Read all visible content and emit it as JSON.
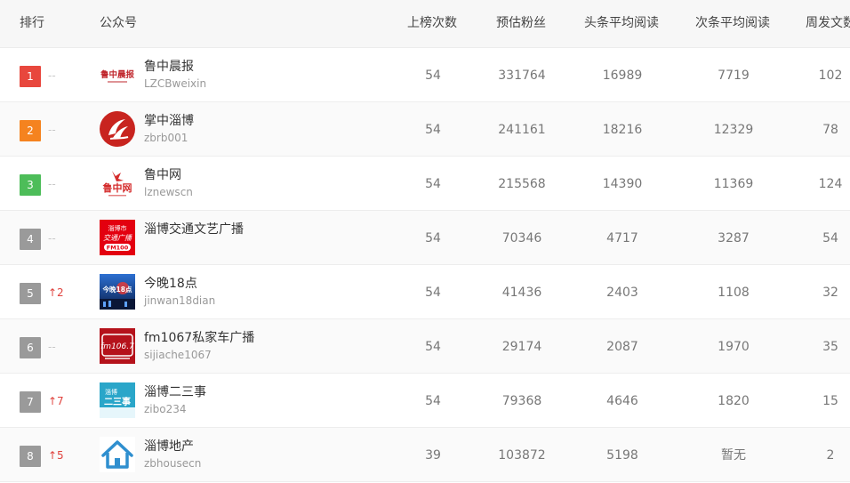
{
  "header": {
    "rank": "排行",
    "account": "公众号",
    "times": "上榜次数",
    "fans": "预估粉丝",
    "head_avg": "头条平均阅读",
    "second_avg": "次条平均阅读",
    "weekly": "周发文数"
  },
  "rank_colors": {
    "1": "#e8473d",
    "2": "#f5831f",
    "3": "#4dbd59",
    "other": "#9a9a9a"
  },
  "rows": [
    {
      "rank": "1",
      "trend": "--",
      "name": "鲁中晨报",
      "wx": "LZCBweixin",
      "times": "54",
      "fans": "331764",
      "head": "16989",
      "second": "7719",
      "weekly": "102",
      "avatar": "luzhong-chenbao-logo"
    },
    {
      "rank": "2",
      "trend": "--",
      "name": "掌中淄博",
      "wx": "zbrb001",
      "times": "54",
      "fans": "241161",
      "head": "18216",
      "second": "12329",
      "weekly": "78",
      "avatar": "zhangzhong-zibo-logo"
    },
    {
      "rank": "3",
      "trend": "--",
      "name": "鲁中网",
      "wx": "lznewscn",
      "times": "54",
      "fans": "215568",
      "head": "14390",
      "second": "11369",
      "weekly": "124",
      "avatar": "luzhong-wang-logo"
    },
    {
      "rank": "4",
      "trend": "--",
      "name": "淄博交通文艺广播",
      "wx": "",
      "times": "54",
      "fans": "70346",
      "head": "4717",
      "second": "3287",
      "weekly": "54",
      "avatar": "zibo-fm100-logo"
    },
    {
      "rank": "5",
      "trend": "↑2",
      "name": "今晚18点",
      "wx": "jinwan18dian",
      "times": "54",
      "fans": "41436",
      "head": "2403",
      "second": "1108",
      "weekly": "32",
      "avatar": "jinwan-18dian-logo"
    },
    {
      "rank": "6",
      "trend": "--",
      "name": "fm1067私家车广播",
      "wx": "sijiache1067",
      "times": "54",
      "fans": "29174",
      "head": "2087",
      "second": "1970",
      "weekly": "35",
      "avatar": "fm1067-logo"
    },
    {
      "rank": "7",
      "trend": "↑7",
      "name": "淄博二三事",
      "wx": "zibo234",
      "times": "54",
      "fans": "79368",
      "head": "4646",
      "second": "1820",
      "weekly": "15",
      "avatar": "zibo-ersanshi-logo"
    },
    {
      "rank": "8",
      "trend": "↑5",
      "name": "淄博地产",
      "wx": "zbhousecn",
      "times": "39",
      "fans": "103872",
      "head": "5198",
      "second": "暂无",
      "weekly": "2",
      "avatar": "house-icon"
    }
  ],
  "logo_text": {
    "chenbao": "鲁中晨报",
    "fm100_top": "淄博市",
    "fm100_mid": "交通广播",
    "fm100_bottom": "FM100",
    "fm1067": "fm106.7",
    "ersanshi_top": "淄博",
    "ersanshi_main": "二三事",
    "jinwan": "今晚18点",
    "luzhongwang": "鲁中网"
  }
}
